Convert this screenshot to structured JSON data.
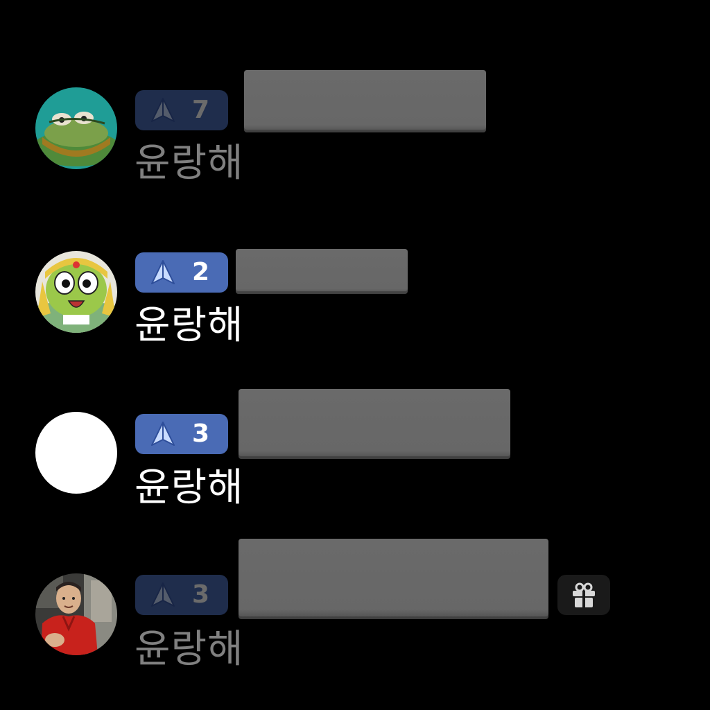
{
  "colors": {
    "background": "#000000",
    "badge_bg": "#4a6bb5",
    "badge_text": "#ffffff",
    "tier_icon": "#c9dcff",
    "nickname": "#ffffff",
    "message_redaction": "#6a6a6a",
    "gift_bg": "#1a1a1a"
  },
  "chat": {
    "messages": [
      {
        "nickname": "윤랑해",
        "level": "7",
        "avatar": "green-frog-avatar-icon",
        "message_redacted": true,
        "faded": true
      },
      {
        "nickname": "윤랑해",
        "level": "2",
        "avatar": "keroro-avatar-icon",
        "message_redacted": true,
        "faded": false
      },
      {
        "nickname": "윤랑해",
        "level": "3",
        "avatar": "blank-white-avatar-icon",
        "message_redacted": true,
        "faded": false
      },
      {
        "nickname": "윤랑해",
        "level": "3",
        "avatar": "person-red-jacket-avatar-icon",
        "message_redacted": true,
        "faded": true,
        "gift_icon": "gift-icon"
      }
    ]
  }
}
